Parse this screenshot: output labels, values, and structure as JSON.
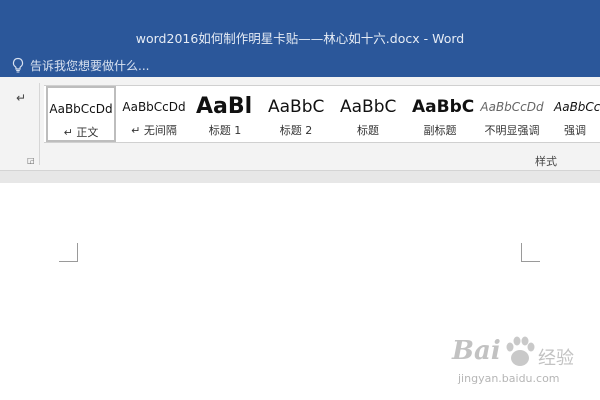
{
  "window": {
    "title": "word2016如何制作明星卡贴——林心如十六.docx - Word"
  },
  "tell_me": {
    "icon": "lightbulb-icon",
    "placeholder": "告诉我您想要做什么..."
  },
  "ribbon": {
    "paragraph_icon": "paragraph-mark-icon",
    "styles_group_label": "样式",
    "styles": [
      {
        "preview": "AaBbCcDd",
        "label": "↵ 正文",
        "selected": true
      },
      {
        "preview": "AaBbCcDd",
        "label": "↵ 无间隔",
        "selected": false
      },
      {
        "preview": "AaBl",
        "label": "标题 1",
        "selected": false
      },
      {
        "preview": "AaBbC",
        "label": "标题 2",
        "selected": false
      },
      {
        "preview": "AaBbC",
        "label": "标题",
        "selected": false
      },
      {
        "preview": "AaBbC",
        "label": "副标题",
        "selected": false
      },
      {
        "preview": "AaBbCcDd",
        "label": "不明显强调",
        "selected": false
      },
      {
        "preview": "AaBbCcDd",
        "label": "强调",
        "selected": false
      }
    ]
  },
  "watermark": {
    "logo": "Bai",
    "logo_suffix": "经验",
    "url": "jingyan.baidu.com"
  },
  "colors": {
    "titlebar": "#2b579a",
    "ribbon_bg": "#f3f3f3"
  }
}
